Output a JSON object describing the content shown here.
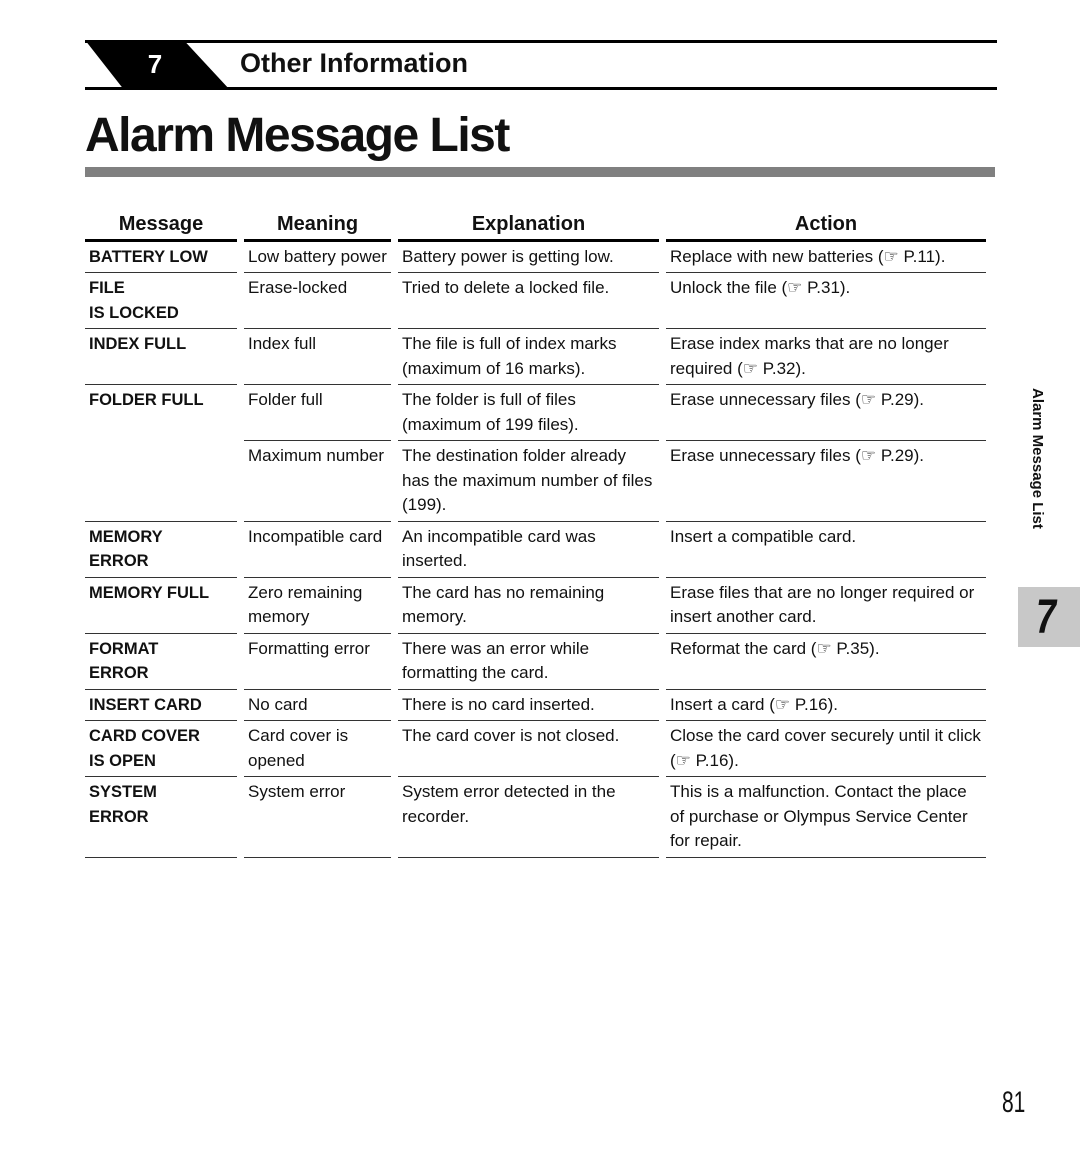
{
  "chapter": {
    "number": "7",
    "title": "Other Information"
  },
  "page_title": "Alarm Message List",
  "table": {
    "headers": [
      "Message",
      "Meaning",
      "Explanation",
      "Action"
    ],
    "rows": [
      {
        "message": "BATTERY LOW",
        "meaning": "Low battery power",
        "explanation": "Battery power is getting low.",
        "action": "Replace with new batteries (☞ P.11)."
      },
      {
        "message": "FILE\nIS LOCKED",
        "meaning": "Erase-locked",
        "explanation": "Tried to delete a locked file.",
        "action": "Unlock the file (☞ P.31)."
      },
      {
        "message": "INDEX FULL",
        "meaning": "Index full",
        "explanation": "The file is full of index marks (maximum of 16 marks).",
        "action": "Erase index marks that are no longer required (☞ P.32)."
      },
      {
        "message": "FOLDER FULL",
        "meaning": "Folder full",
        "explanation": "The folder is full of files (maximum of 199 files).",
        "action": "Erase unnecessary files (☞ P.29)."
      },
      {
        "message": "",
        "meaning": "Maximum number",
        "explanation": "The destination folder already has the maximum number of files (199).",
        "action": "Erase unnecessary files (☞ P.29)."
      },
      {
        "message": "MEMORY\nERROR",
        "meaning": "Incompatible card",
        "explanation": "An incompatible card was inserted.",
        "action": "Insert a compatible card."
      },
      {
        "message": "MEMORY FULL",
        "meaning": "Zero remaining memory",
        "explanation": "The card has no remaining memory.",
        "action": "Erase files that are no longer required or insert another card."
      },
      {
        "message": "FORMAT\nERROR",
        "meaning": "Formatting error",
        "explanation": "There was an error while formatting the card.",
        "action": "Reformat the card (☞ P.35)."
      },
      {
        "message": "INSERT CARD",
        "meaning": "No card",
        "explanation": "There is no card inserted.",
        "action": "Insert a card (☞ P.16)."
      },
      {
        "message": "CARD  COVER\nIS OPEN",
        "meaning": "Card cover is opened",
        "explanation": "The card cover is not closed.",
        "action": "Close the card cover securely until it click (☞ P.16)."
      },
      {
        "message": "SYSTEM\nERROR",
        "meaning": "System error",
        "explanation": "System error detected in the recorder.",
        "action": "This is a malfunction. Contact the place of purchase or Olympus Service Center for repair."
      }
    ]
  },
  "side_tab": {
    "label": "Alarm Message List",
    "chapter": "7"
  },
  "page_number": "81"
}
